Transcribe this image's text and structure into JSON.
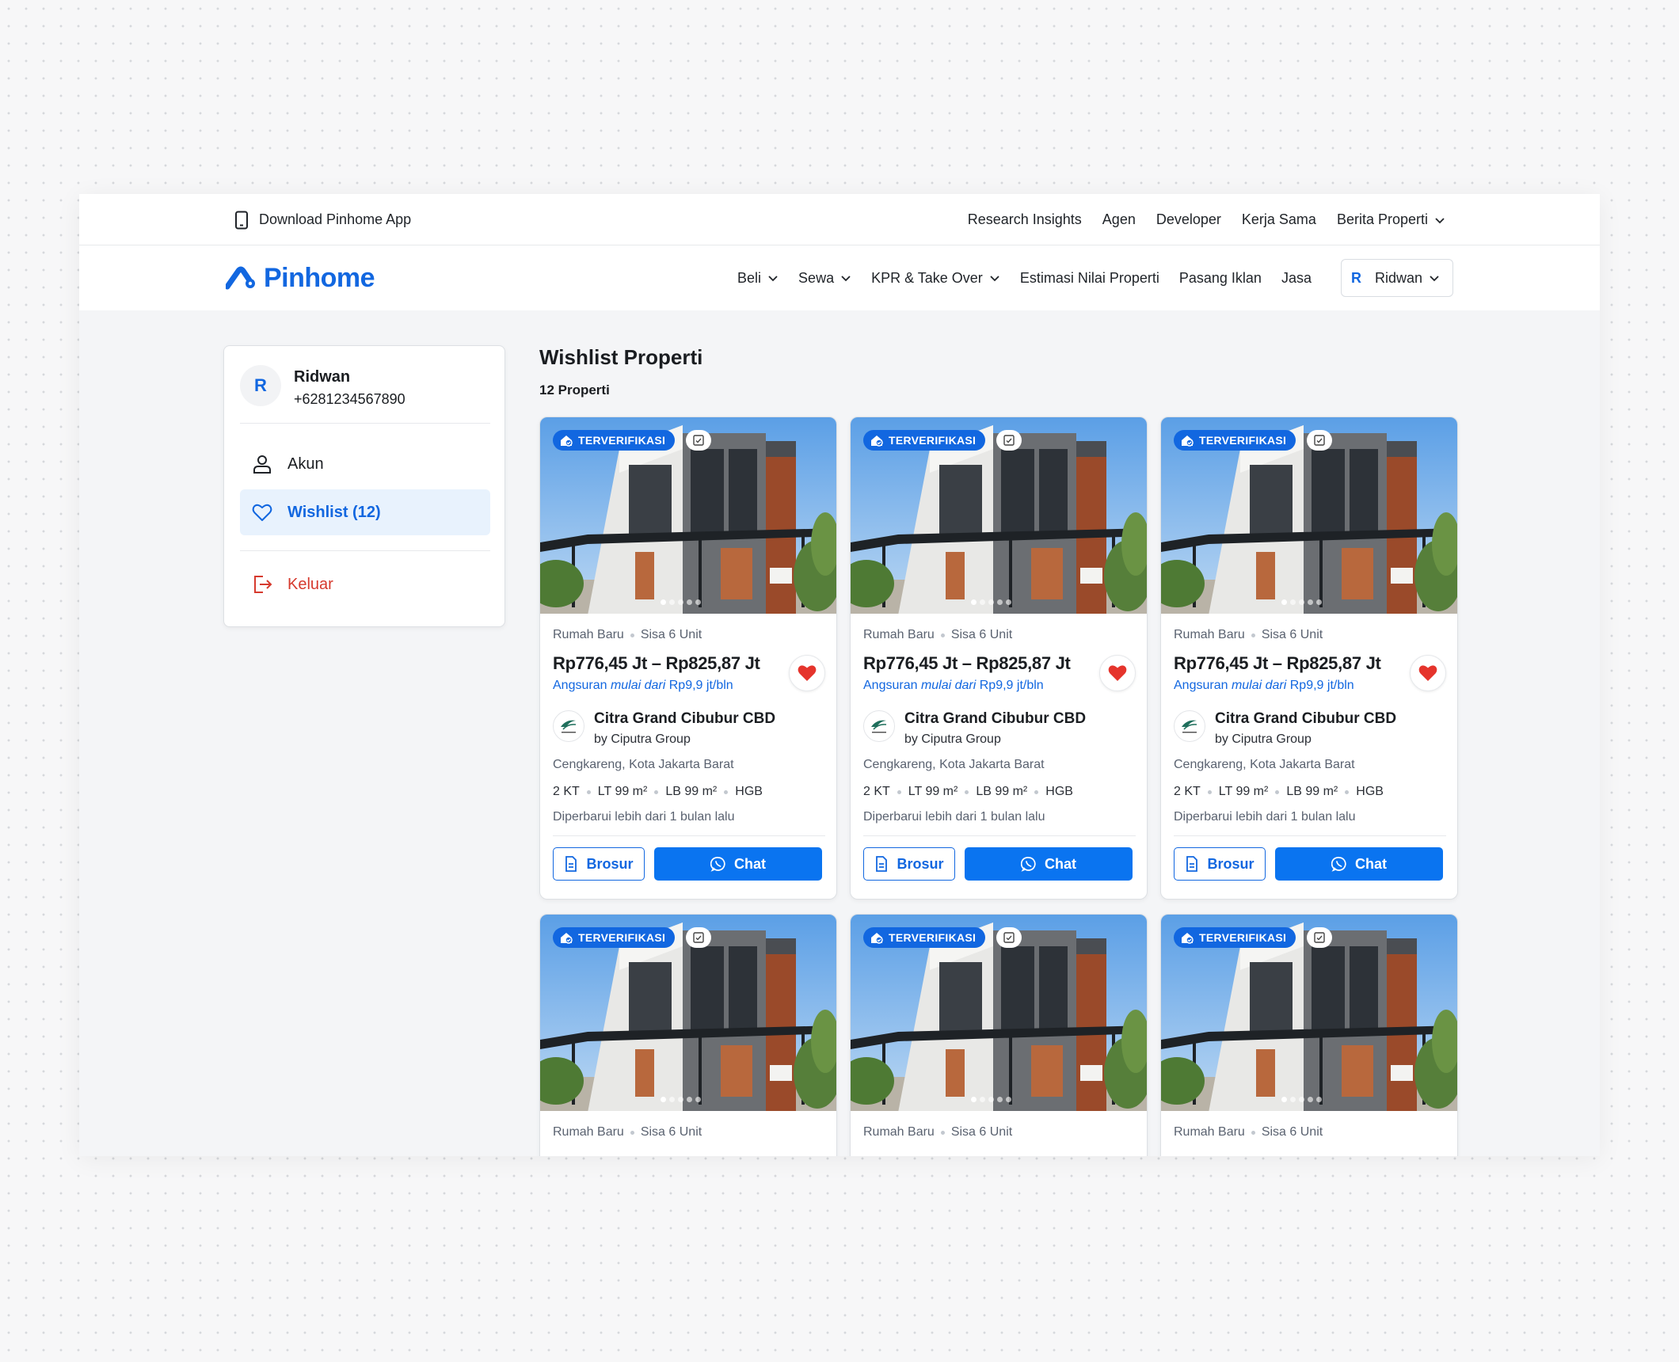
{
  "topbar": {
    "download_label": "Download Pinhome App",
    "links": [
      "Research Insights",
      "Agen",
      "Developer",
      "Kerja Sama",
      "Berita Properti"
    ]
  },
  "navbar": {
    "logo_text": "Pinhome",
    "items": [
      "Beli",
      "Sewa",
      "KPR & Take Over",
      "Estimasi Nilai Properti",
      "Pasang Iklan",
      "Jasa"
    ],
    "user_initial": "R",
    "user_name": "Ridwan"
  },
  "sidebar": {
    "initial": "R",
    "name": "Ridwan",
    "phone": "+6281234567890",
    "items": [
      {
        "label": "Akun",
        "icon": "user-icon"
      },
      {
        "label": "Wishlist (12)",
        "icon": "heart-icon",
        "active": true
      },
      {
        "label": "Keluar",
        "icon": "logout-icon"
      }
    ]
  },
  "wishlist": {
    "title": "Wishlist Properti",
    "count": "12 Properti",
    "cards": [
      {
        "badge": "TERVERIFIKASI",
        "type": "Rumah Baru",
        "stock": "Sisa 6 Unit",
        "price": "Rp776,45 Jt – Rp825,87 Jt",
        "installment_prefix": "Angsuran ",
        "installment_italic": "mulai dari",
        "installment_suffix": " Rp9,9 jt/bln",
        "developer": "Citra Grand Cibubur CBD",
        "by": "by Ciputra Group",
        "location": "Cengkareng, Kota Jakarta Barat",
        "specs": [
          "2 KT",
          "LT 99 m²",
          "LB 99 m²",
          "HGB"
        ],
        "updated": "Diperbarui lebih dari 1 bulan lalu",
        "brosur": "Brosur",
        "chat": "Chat"
      },
      {
        "badge": "TERVERIFIKASI",
        "type": "Rumah Baru",
        "stock": "Sisa 6 Unit",
        "price": "Rp776,45 Jt – Rp825,87 Jt",
        "installment_prefix": "Angsuran ",
        "installment_italic": "mulai dari",
        "installment_suffix": " Rp9,9 jt/bln",
        "developer": "Citra Grand Cibubur CBD",
        "by": "by Ciputra Group",
        "location": "Cengkareng, Kota Jakarta Barat",
        "specs": [
          "2 KT",
          "LT 99 m²",
          "LB 99 m²",
          "HGB"
        ],
        "updated": "Diperbarui lebih dari 1 bulan lalu",
        "brosur": "Brosur",
        "chat": "Chat"
      },
      {
        "badge": "TERVERIFIKASI",
        "type": "Rumah Baru",
        "stock": "Sisa 6 Unit",
        "price": "Rp776,45 Jt – Rp825,87 Jt",
        "installment_prefix": "Angsuran ",
        "installment_italic": "mulai dari",
        "installment_suffix": " Rp9,9 jt/bln",
        "developer": "Citra Grand Cibubur CBD",
        "by": "by Ciputra Group",
        "location": "Cengkareng, Kota Jakarta Barat",
        "specs": [
          "2 KT",
          "LT 99 m²",
          "LB 99 m²",
          "HGB"
        ],
        "updated": "Diperbarui lebih dari 1 bulan lalu",
        "brosur": "Brosur",
        "chat": "Chat"
      },
      {
        "badge": "TERVERIFIKASI",
        "type": "Rumah Baru",
        "stock": "Sisa 6 Unit"
      },
      {
        "badge": "TERVERIFIKASI",
        "type": "Rumah Baru",
        "stock": "Sisa 6 Unit"
      },
      {
        "badge": "TERVERIFIKASI",
        "type": "Rumah Baru",
        "stock": "Sisa 6 Unit"
      }
    ]
  },
  "colors": {
    "brand": "#1267e0",
    "chat_button": "#0a74f0",
    "logout": "#d63a2e",
    "heart": "#e5342c"
  }
}
